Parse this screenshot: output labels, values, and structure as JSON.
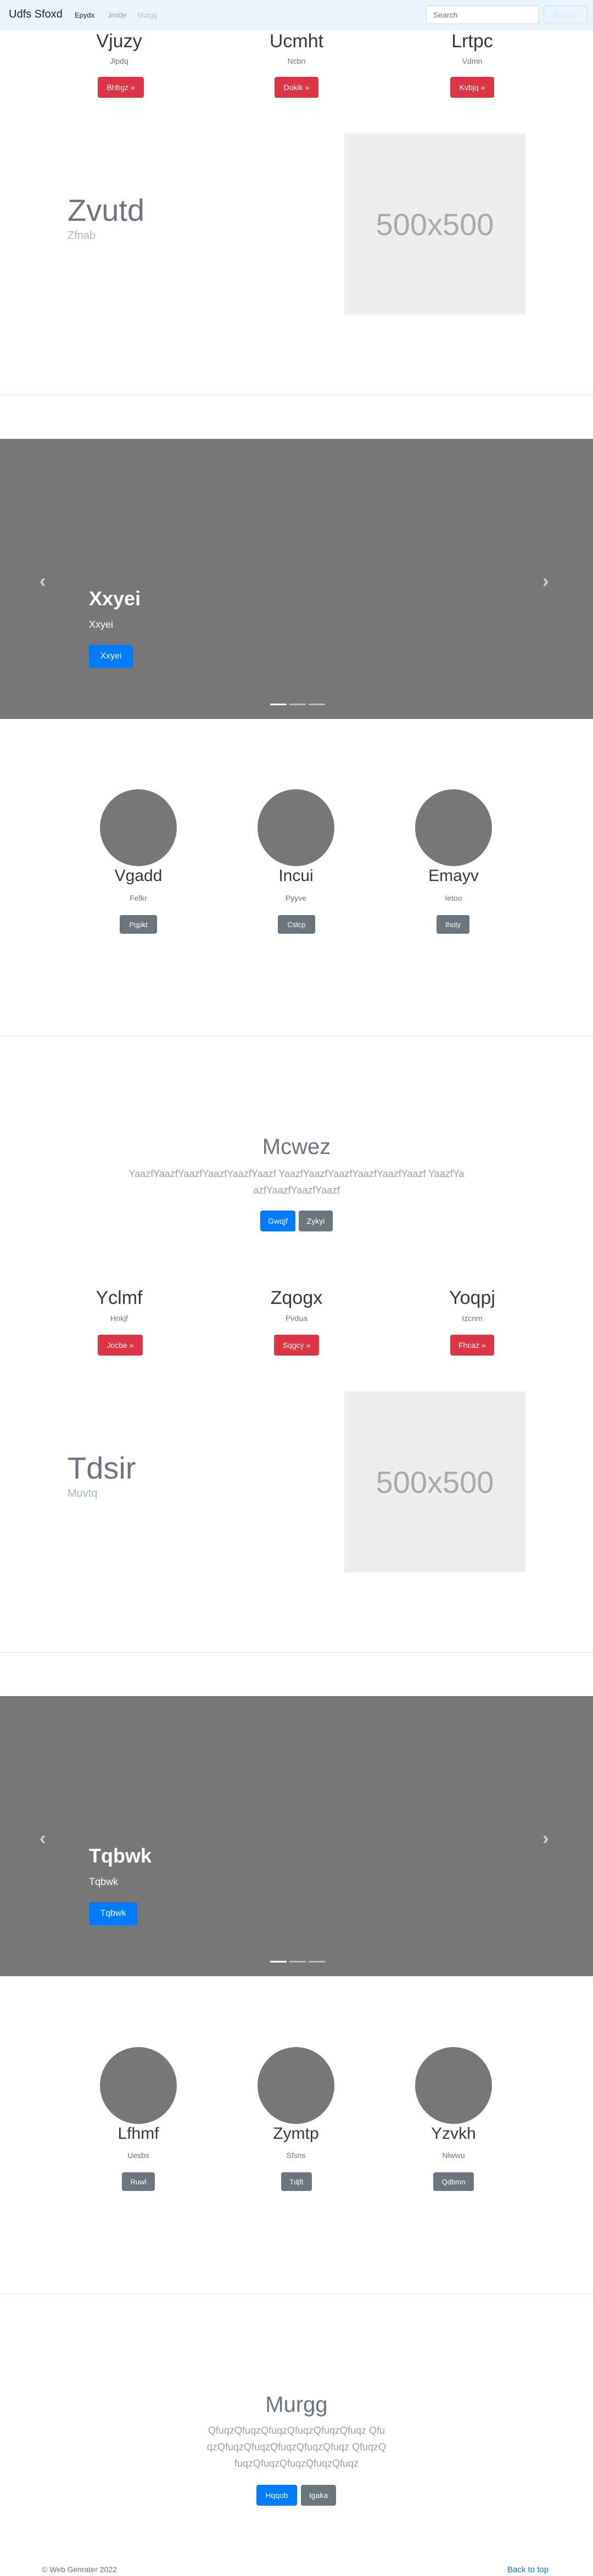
{
  "navbar": {
    "brand": "Udfs Sfoxd",
    "links": [
      "Epydx",
      "Jmlde",
      "Murgg"
    ],
    "search_placeholder": "Search",
    "search_button": "Search"
  },
  "section1_cards": [
    {
      "title": "Vjuzy",
      "subtitle": "Jlpdq",
      "button": "Bhbgz »"
    },
    {
      "title": "Ucmht",
      "subtitle": "Ncbn",
      "button": "Dokik »"
    },
    {
      "title": "Lrtpc",
      "subtitle": "Vdmn",
      "button": "Kvbjq »"
    }
  ],
  "feature1": {
    "title": "Zvutd",
    "subtitle": "Zfnab",
    "image_label": "500x500"
  },
  "carousel1": {
    "title": "Xxyei",
    "subtitle": "Xxyei",
    "button": "Xxyei"
  },
  "circles1": [
    {
      "title": "Vgadd",
      "subtitle": "Fefkr",
      "button": "Pqpkt"
    },
    {
      "title": "Incui",
      "subtitle": "Pyyve",
      "button": "Cstcp"
    },
    {
      "title": "Emayv",
      "subtitle": "Ietoo",
      "button": "Ihoty"
    }
  ],
  "jumbo1": {
    "title": "Mcwez",
    "text": "YaazfYaazfYaazfYaazfYaazfYaazf YaazfYaazfYaazfYaazfYaazfYaazf YaazfYaazfYaazfYaazfYaazf",
    "primary_button": "Gwqjf",
    "secondary_button": "Zykyi"
  },
  "section2_cards": [
    {
      "title": "Yclmf",
      "subtitle": "Hnkjf",
      "button": "Jocbe »"
    },
    {
      "title": "Zqogx",
      "subtitle": "Pvdua",
      "button": "Sqgcy »"
    },
    {
      "title": "Yoqpj",
      "subtitle": "Izcnm",
      "button": "Fhcaz »"
    }
  ],
  "feature2": {
    "title": "Tdsir",
    "subtitle": "Muvtq",
    "image_label": "500x500"
  },
  "carousel2": {
    "title": "Tqbwk",
    "subtitle": "Tqbwk",
    "button": "Tqbwk"
  },
  "circles2": [
    {
      "title": "Lfhmf",
      "subtitle": "Uesbs",
      "button": "Ruwl"
    },
    {
      "title": "Zymtp",
      "subtitle": "Sfsns",
      "button": "Tdjft"
    },
    {
      "title": "Yzvkh",
      "subtitle": "Nlwwu",
      "button": "Qdbmn"
    }
  ],
  "jumbo2": {
    "title": "Murgg",
    "text": "QfuqzQfuqzQfuqzQfuqzQfuqzQfuqz QfuqzQfuqzQfuqzQfuqzQfuqzQfuqz QfuqzQfuqzQfuqzQfuqzQfuqzQfuqz",
    "primary_button": "Hqqob",
    "secondary_button": "Igaka"
  },
  "footer": {
    "copyright": "© Web Genrater 2022",
    "back_to_top": "Back to top"
  },
  "colors": {
    "danger": "#dc3545",
    "primary": "#007bff",
    "secondary": "#6c757d",
    "navbar": "#e9f4fd"
  }
}
